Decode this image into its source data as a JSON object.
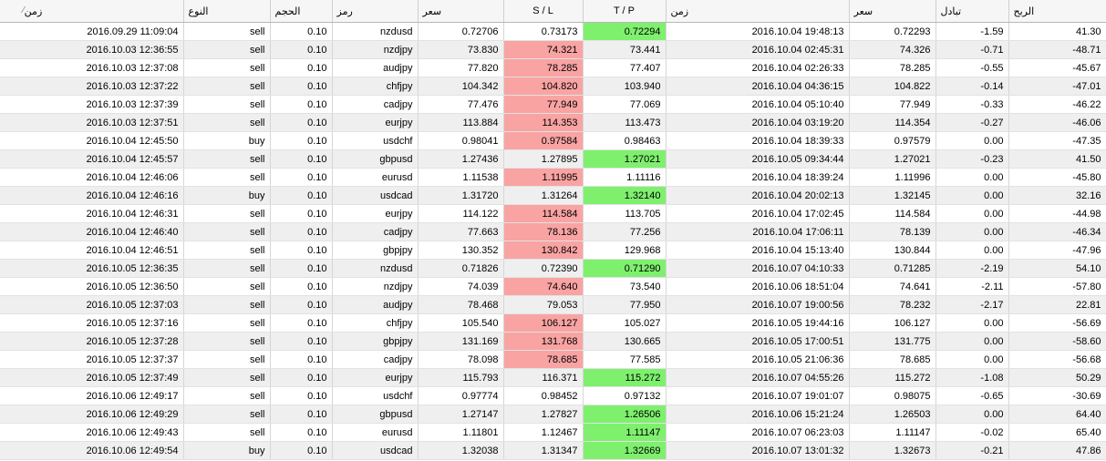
{
  "columns": {
    "open_time": "زمن",
    "type": "النوع",
    "volume": "الحجم",
    "symbol": "رمز",
    "open_price": "سعر",
    "sl": "S / L",
    "tp": "T / P",
    "close_time": "زمن",
    "close_price": "سعر",
    "swap": "تبادل",
    "profit": "الربح",
    "sort_indicator": "⁄"
  },
  "highlight_colors": {
    "sl_hit": "#f9a3a3",
    "tp_hit": "#7ef06e"
  },
  "rows": [
    {
      "open_time": "2016.09.29 11:09:04",
      "type": "sell",
      "volume": "0.10",
      "symbol": "nzdusd",
      "open_price": "0.72706",
      "sl": "0.73173",
      "tp": "0.72294",
      "close_time": "2016.10.04 19:48:13",
      "close_price": "0.72293",
      "swap": "-1.59",
      "profit": "41.30",
      "hit": "tp"
    },
    {
      "open_time": "2016.10.03 12:36:55",
      "type": "sell",
      "volume": "0.10",
      "symbol": "nzdjpy",
      "open_price": "73.830",
      "sl": "74.321",
      "tp": "73.441",
      "close_time": "2016.10.04 02:45:31",
      "close_price": "74.326",
      "swap": "-0.71",
      "profit": "-48.71",
      "hit": "sl"
    },
    {
      "open_time": "2016.10.03 12:37:08",
      "type": "sell",
      "volume": "0.10",
      "symbol": "audjpy",
      "open_price": "77.820",
      "sl": "78.285",
      "tp": "77.407",
      "close_time": "2016.10.04 02:26:33",
      "close_price": "78.285",
      "swap": "-0.55",
      "profit": "-45.67",
      "hit": "sl"
    },
    {
      "open_time": "2016.10.03 12:37:22",
      "type": "sell",
      "volume": "0.10",
      "symbol": "chfjpy",
      "open_price": "104.342",
      "sl": "104.820",
      "tp": "103.940",
      "close_time": "2016.10.04 04:36:15",
      "close_price": "104.822",
      "swap": "-0.14",
      "profit": "-47.01",
      "hit": "sl"
    },
    {
      "open_time": "2016.10.03 12:37:39",
      "type": "sell",
      "volume": "0.10",
      "symbol": "cadjpy",
      "open_price": "77.476",
      "sl": "77.949",
      "tp": "77.069",
      "close_time": "2016.10.04 05:10:40",
      "close_price": "77.949",
      "swap": "-0.33",
      "profit": "-46.22",
      "hit": "sl"
    },
    {
      "open_time": "2016.10.03 12:37:51",
      "type": "sell",
      "volume": "0.10",
      "symbol": "eurjpy",
      "open_price": "113.884",
      "sl": "114.353",
      "tp": "113.473",
      "close_time": "2016.10.04 03:19:20",
      "close_price": "114.354",
      "swap": "-0.27",
      "profit": "-46.06",
      "hit": "sl"
    },
    {
      "open_time": "2016.10.04 12:45:50",
      "type": "buy",
      "volume": "0.10",
      "symbol": "usdchf",
      "open_price": "0.98041",
      "sl": "0.97584",
      "tp": "0.98463",
      "close_time": "2016.10.04 18:39:33",
      "close_price": "0.97579",
      "swap": "0.00",
      "profit": "-47.35",
      "hit": "sl"
    },
    {
      "open_time": "2016.10.04 12:45:57",
      "type": "sell",
      "volume": "0.10",
      "symbol": "gbpusd",
      "open_price": "1.27436",
      "sl": "1.27895",
      "tp": "1.27021",
      "close_time": "2016.10.05 09:34:44",
      "close_price": "1.27021",
      "swap": "-0.23",
      "profit": "41.50",
      "hit": "tp"
    },
    {
      "open_time": "2016.10.04 12:46:06",
      "type": "sell",
      "volume": "0.10",
      "symbol": "eurusd",
      "open_price": "1.11538",
      "sl": "1.11995",
      "tp": "1.11116",
      "close_time": "2016.10.04 18:39:24",
      "close_price": "1.11996",
      "swap": "0.00",
      "profit": "-45.80",
      "hit": "sl"
    },
    {
      "open_time": "2016.10.04 12:46:16",
      "type": "buy",
      "volume": "0.10",
      "symbol": "usdcad",
      "open_price": "1.31720",
      "sl": "1.31264",
      "tp": "1.32140",
      "close_time": "2016.10.04 20:02:13",
      "close_price": "1.32145",
      "swap": "0.00",
      "profit": "32.16",
      "hit": "tp"
    },
    {
      "open_time": "2016.10.04 12:46:31",
      "type": "sell",
      "volume": "0.10",
      "symbol": "eurjpy",
      "open_price": "114.122",
      "sl": "114.584",
      "tp": "113.705",
      "close_time": "2016.10.04 17:02:45",
      "close_price": "114.584",
      "swap": "0.00",
      "profit": "-44.98",
      "hit": "sl"
    },
    {
      "open_time": "2016.10.04 12:46:40",
      "type": "sell",
      "volume": "0.10",
      "symbol": "cadjpy",
      "open_price": "77.663",
      "sl": "78.136",
      "tp": "77.256",
      "close_time": "2016.10.04 17:06:11",
      "close_price": "78.139",
      "swap": "0.00",
      "profit": "-46.34",
      "hit": "sl"
    },
    {
      "open_time": "2016.10.04 12:46:51",
      "type": "sell",
      "volume": "0.10",
      "symbol": "gbpjpy",
      "open_price": "130.352",
      "sl": "130.842",
      "tp": "129.968",
      "close_time": "2016.10.04 15:13:40",
      "close_price": "130.844",
      "swap": "0.00",
      "profit": "-47.96",
      "hit": "sl"
    },
    {
      "open_time": "2016.10.05 12:36:35",
      "type": "sell",
      "volume": "0.10",
      "symbol": "nzdusd",
      "open_price": "0.71826",
      "sl": "0.72390",
      "tp": "0.71290",
      "close_time": "2016.10.07 04:10:33",
      "close_price": "0.71285",
      "swap": "-2.19",
      "profit": "54.10",
      "hit": "tp"
    },
    {
      "open_time": "2016.10.05 12:36:50",
      "type": "sell",
      "volume": "0.10",
      "symbol": "nzdjpy",
      "open_price": "74.039",
      "sl": "74.640",
      "tp": "73.540",
      "close_time": "2016.10.06 18:51:04",
      "close_price": "74.641",
      "swap": "-2.11",
      "profit": "-57.80",
      "hit": "sl"
    },
    {
      "open_time": "2016.10.05 12:37:03",
      "type": "sell",
      "volume": "0.10",
      "symbol": "audjpy",
      "open_price": "78.468",
      "sl": "79.053",
      "tp": "77.950",
      "close_time": "2016.10.07 19:00:56",
      "close_price": "78.232",
      "swap": "-2.17",
      "profit": "22.81",
      "hit": ""
    },
    {
      "open_time": "2016.10.05 12:37:16",
      "type": "sell",
      "volume": "0.10",
      "symbol": "chfjpy",
      "open_price": "105.540",
      "sl": "106.127",
      "tp": "105.027",
      "close_time": "2016.10.05 19:44:16",
      "close_price": "106.127",
      "swap": "0.00",
      "profit": "-56.69",
      "hit": "sl"
    },
    {
      "open_time": "2016.10.05 12:37:28",
      "type": "sell",
      "volume": "0.10",
      "symbol": "gbpjpy",
      "open_price": "131.169",
      "sl": "131.768",
      "tp": "130.665",
      "close_time": "2016.10.05 17:00:51",
      "close_price": "131.775",
      "swap": "0.00",
      "profit": "-58.60",
      "hit": "sl"
    },
    {
      "open_time": "2016.10.05 12:37:37",
      "type": "sell",
      "volume": "0.10",
      "symbol": "cadjpy",
      "open_price": "78.098",
      "sl": "78.685",
      "tp": "77.585",
      "close_time": "2016.10.05 21:06:36",
      "close_price": "78.685",
      "swap": "0.00",
      "profit": "-56.68",
      "hit": "sl"
    },
    {
      "open_time": "2016.10.05 12:37:49",
      "type": "sell",
      "volume": "0.10",
      "symbol": "eurjpy",
      "open_price": "115.793",
      "sl": "116.371",
      "tp": "115.272",
      "close_time": "2016.10.07 04:55:26",
      "close_price": "115.272",
      "swap": "-1.08",
      "profit": "50.29",
      "hit": "tp"
    },
    {
      "open_time": "2016.10.06 12:49:17",
      "type": "sell",
      "volume": "0.10",
      "symbol": "usdchf",
      "open_price": "0.97774",
      "sl": "0.98452",
      "tp": "0.97132",
      "close_time": "2016.10.07 19:01:07",
      "close_price": "0.98075",
      "swap": "-0.65",
      "profit": "-30.69",
      "hit": ""
    },
    {
      "open_time": "2016.10.06 12:49:29",
      "type": "sell",
      "volume": "0.10",
      "symbol": "gbpusd",
      "open_price": "1.27147",
      "sl": "1.27827",
      "tp": "1.26506",
      "close_time": "2016.10.06 15:21:24",
      "close_price": "1.26503",
      "swap": "0.00",
      "profit": "64.40",
      "hit": "tp"
    },
    {
      "open_time": "2016.10.06 12:49:43",
      "type": "sell",
      "volume": "0.10",
      "symbol": "eurusd",
      "open_price": "1.11801",
      "sl": "1.12467",
      "tp": "1.11147",
      "close_time": "2016.10.07 06:23:03",
      "close_price": "1.11147",
      "swap": "-0.02",
      "profit": "65.40",
      "hit": "tp"
    },
    {
      "open_time": "2016.10.06 12:49:54",
      "type": "buy",
      "volume": "0.10",
      "symbol": "usdcad",
      "open_price": "1.32038",
      "sl": "1.31347",
      "tp": "1.32669",
      "close_time": "2016.10.07 13:01:32",
      "close_price": "1.32673",
      "swap": "-0.21",
      "profit": "47.86",
      "hit": "tp"
    }
  ]
}
